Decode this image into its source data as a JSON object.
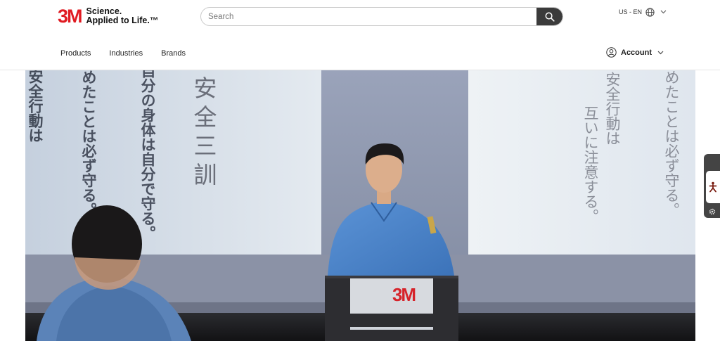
{
  "header": {
    "logo": {
      "mark": "3M",
      "tagline_line1": "Science.",
      "tagline_line2": "Applied to Life.™"
    },
    "search": {
      "placeholder": "Search",
      "value": "",
      "button_icon": "search-icon"
    },
    "locale": {
      "label": "US - EN",
      "icon": "globe-icon"
    },
    "nav": [
      {
        "label": "Products"
      },
      {
        "label": "Industries"
      },
      {
        "label": "Brands"
      }
    ],
    "account": {
      "label": "Account",
      "icon": "user-circle-icon"
    }
  },
  "hero": {
    "screen_left": [
      "安全行動は",
      "決めたことは必ず守る。",
      "自分の身体は自分で守る。",
      "安全三訓"
    ],
    "screen_right": [
      "安全行動は",
      "互いに注意する。",
      "決めたことは必ず守る。"
    ],
    "podium_logo": "3M"
  },
  "side_tab": {
    "icon": "accessibility-icon",
    "secondary_icon": "gear-icon"
  },
  "colors": {
    "brand_red": "#e01b22",
    "search_button": "#3b3b3b",
    "hero_bg": "#8e97ad"
  }
}
